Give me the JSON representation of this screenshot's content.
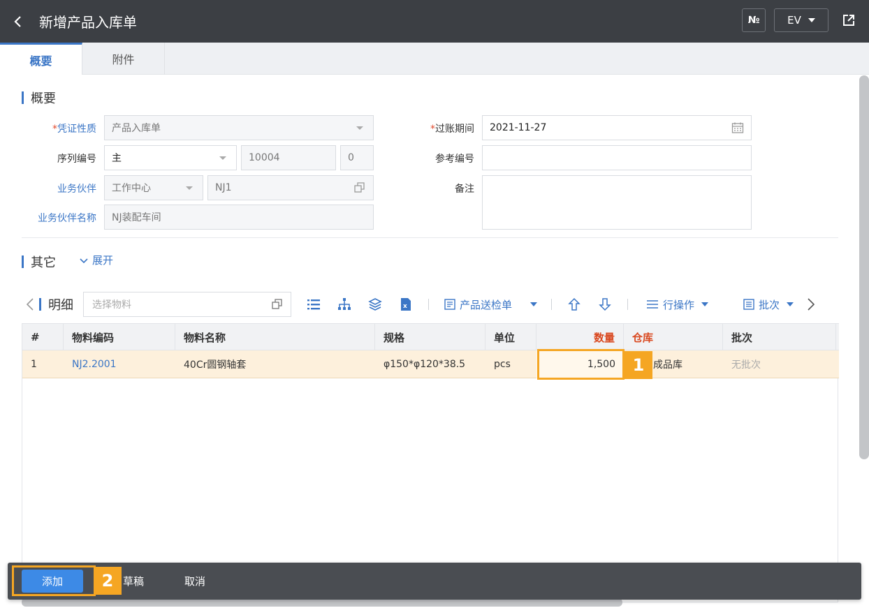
{
  "header": {
    "title": "新增产品入库单",
    "no_label": "№",
    "ev_label": "EV"
  },
  "tabs": [
    {
      "label": "概要"
    },
    {
      "label": "附件"
    }
  ],
  "sections": {
    "summary": "概要",
    "other": "其它",
    "expand": "展开",
    "detail": "明细"
  },
  "form": {
    "voucher_type": {
      "label": "凭证性质",
      "value": "产品入库单"
    },
    "sequence": {
      "label": "序列编号",
      "value": "主",
      "number": "10004",
      "suffix": "0"
    },
    "partner": {
      "label": "业务伙伴",
      "type": "工作中心",
      "code": "NJ1"
    },
    "partner_name": {
      "label": "业务伙伴名称",
      "value": "NJ装配车间"
    },
    "posting_period": {
      "label": "过账期间",
      "value": "2021-11-27"
    },
    "reference_no": {
      "label": "参考编号",
      "value": ""
    },
    "remark": {
      "label": "备注",
      "value": ""
    }
  },
  "toolbar": {
    "material_placeholder": "选择物料",
    "inspection_label": "产品送检单",
    "row_ops_label": "行操作",
    "batch_label": "批次"
  },
  "table": {
    "headers": [
      "#",
      "物料编码",
      "物料名称",
      "规格",
      "单位",
      "数量",
      "仓库",
      "批次"
    ],
    "rows": [
      {
        "idx": "1",
        "code": "NJ2.2001",
        "name": "40Cr圆钢轴套",
        "spec": "φ150*φ120*38.5",
        "unit": "pcs",
        "qty": "1,500",
        "warehouse": "成品库",
        "batch": "无批次"
      }
    ]
  },
  "annotations": {
    "badge1": "1",
    "badge2": "2"
  },
  "bottombar": {
    "add": "添加",
    "draft": "草稿",
    "cancel": "取消"
  },
  "colors": {
    "header_bg": "#3c3f44",
    "accent": "#3b76c6",
    "highlight": "#f5a623",
    "row_bg": "#fdf0dc",
    "required": "#e24c2f"
  }
}
